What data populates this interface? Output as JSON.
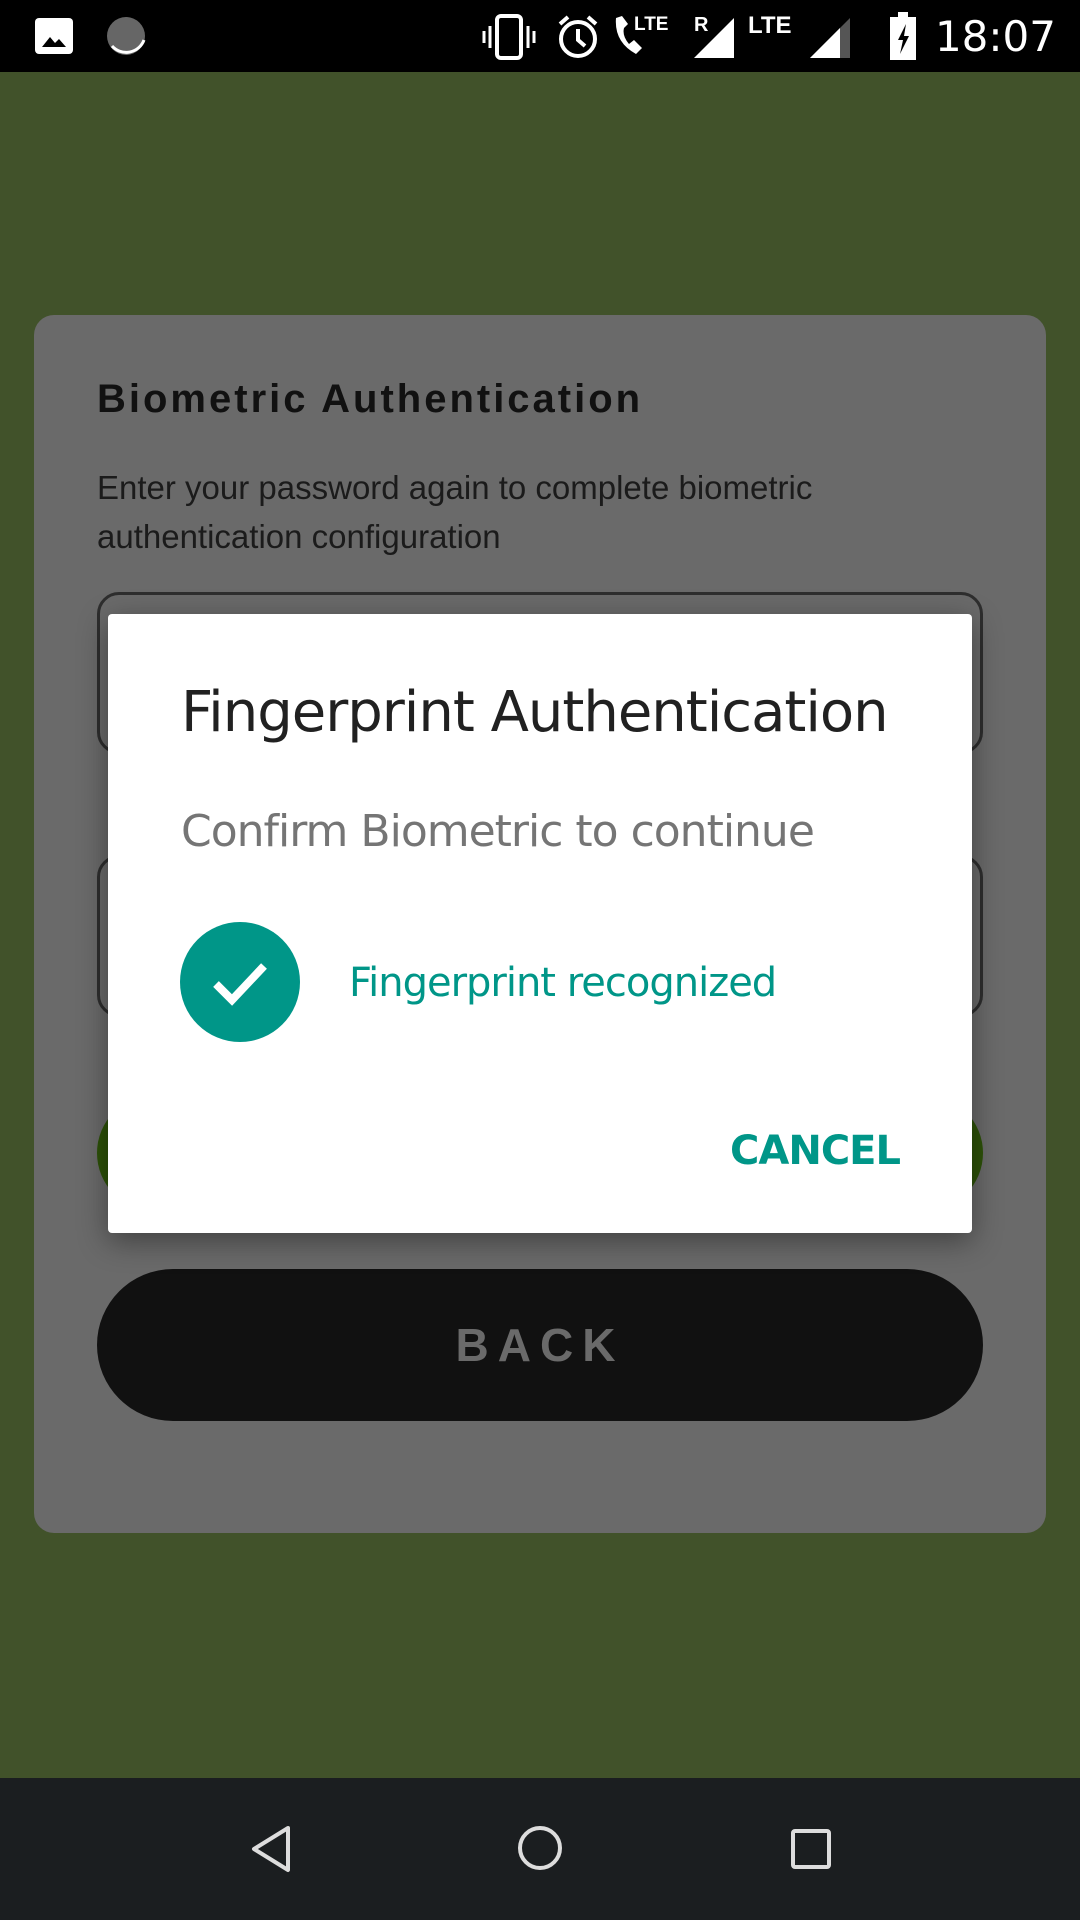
{
  "status_bar": {
    "time": "18:07",
    "icons": [
      "image-icon",
      "sync-icon",
      "vibrate-icon",
      "alarm-icon",
      "volte-call-icon",
      "signal-roaming-icon",
      "lte-icon",
      "signal-icon",
      "battery-charging-icon"
    ],
    "lte_label": "LTE",
    "roaming_label": "R"
  },
  "card": {
    "title": "Biometric Authentication",
    "description": "Enter your password again to complete biometric authentication configuration",
    "back_label": "BACK"
  },
  "dialog": {
    "title": "Fingerprint Authentication",
    "subtitle": "Confirm Biometric to continue",
    "status": "Fingerprint recognized",
    "cancel_label": "CANCEL",
    "accent": "#009688"
  },
  "nav": {
    "icons": [
      "back-icon",
      "home-icon",
      "recents-icon"
    ]
  }
}
